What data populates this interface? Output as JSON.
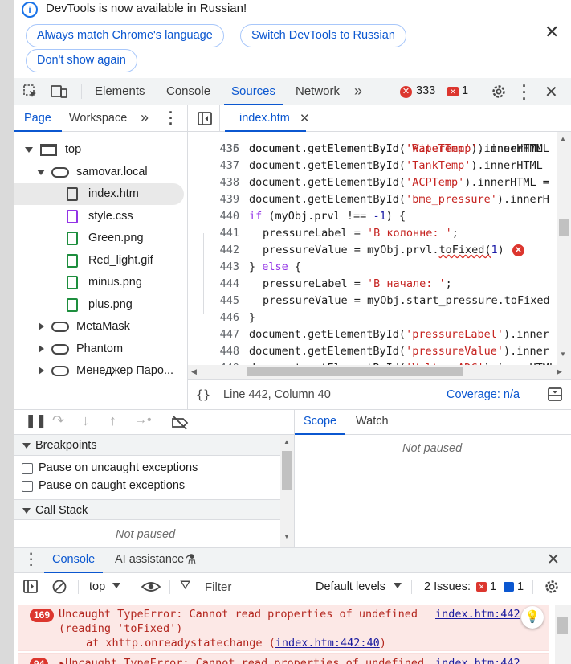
{
  "infobar": {
    "message": "DevTools is now available in Russian!",
    "btn_match": "Always match Chrome's language",
    "btn_switch": "Switch DevTools to Russian",
    "btn_dont_show": "Don't show again"
  },
  "toolbar": {
    "tabs": [
      "Elements",
      "Console",
      "Sources",
      "Network"
    ],
    "active_tab": "Sources",
    "error_count": "333",
    "warning_count": "1"
  },
  "navigator": {
    "tabs": [
      "Page",
      "Workspace"
    ],
    "active_tab": "Page",
    "tree": [
      {
        "label": "top",
        "type": "frame"
      },
      {
        "label": "samovar.local",
        "type": "domain"
      },
      {
        "label": "index.htm",
        "type": "file-html"
      },
      {
        "label": "style.css",
        "type": "file-css"
      },
      {
        "label": "Green.png",
        "type": "file-img"
      },
      {
        "label": "Red_light.gif",
        "type": "file-img"
      },
      {
        "label": "minus.png",
        "type": "file-img"
      },
      {
        "label": "plus.png",
        "type": "file-img"
      },
      {
        "label": "MetaMask",
        "type": "extension"
      },
      {
        "label": "Phantom",
        "type": "extension"
      },
      {
        "label": "Менеджер Паро...",
        "type": "extension"
      }
    ]
  },
  "editor": {
    "open_file": "index.htm",
    "lines": [
      {
        "n": "436",
        "pre": "document.getElementById(",
        "str": "'WaterTemp'",
        "post": ").innerHTML",
        "indent": 0
      },
      {
        "n": "437",
        "pre": "document.getElementById(",
        "str": "'TankTemp'",
        "post": ").innerHTML",
        "indent": 0
      },
      {
        "n": "438",
        "pre": "document.getElementById(",
        "str": "'ACPTemp'",
        "post": ").innerHTML =",
        "indent": 0
      },
      {
        "n": "439",
        "pre": "document.getElementById(",
        "str": "'bme_pressure'",
        "post": ").innerH",
        "indent": 0
      },
      {
        "n": "440",
        "kw": "if",
        "pre": " (myObj.prvl !== ",
        "num": "-1",
        "post": ") {",
        "indent": 0
      },
      {
        "n": "441",
        "pre": "pressureLabel = ",
        "str": "'В колонне: '",
        "post": ";",
        "indent": 1
      },
      {
        "n": "442",
        "pre": "pressureValue = myObj.prvl.",
        "squig": "toFixed(",
        "num": "1",
        "post": ")",
        "indent": 1,
        "error": true
      },
      {
        "n": "443",
        "pre": "} ",
        "kw": "else",
        "post": " {",
        "indent": 0
      },
      {
        "n": "444",
        "pre": "pressureLabel = ",
        "str": "'В начале: '",
        "post": ";",
        "indent": 1
      },
      {
        "n": "445",
        "pre": "pressureValue = myObj.start_pressure.toFixed",
        "indent": 1
      },
      {
        "n": "446",
        "pre": "}",
        "indent": 0
      },
      {
        "n": "447",
        "pre": "document.getElementById(",
        "str": "'pressureLabel'",
        "post": ").inner",
        "indent": 0
      },
      {
        "n": "448",
        "pre": "document.getElementById(",
        "str": "'pressureValue'",
        "post": ").inner",
        "indent": 0
      }
    ],
    "position": "Line 442, Column 40",
    "coverage": "Coverage: n/a"
  },
  "debugger": {
    "breakpoints_title": "Breakpoints",
    "pause_uncaught": "Pause on uncaught exceptions",
    "pause_caught": "Pause on caught exceptions",
    "callstack_title": "Call Stack",
    "not_paused": "Not paused",
    "scope_tabs": [
      "Scope",
      "Watch"
    ],
    "scope_status": "Not paused"
  },
  "drawer": {
    "tabs": [
      "Console",
      "AI assistance"
    ],
    "context": "top",
    "filter_placeholder": "Filter",
    "levels": "Default levels",
    "issues_label": "2 Issues:",
    "issues_errors": "1",
    "issues_info": "1"
  },
  "console_messages": [
    {
      "count": "169",
      "line1": "Uncaught TypeError: Cannot read properties of undefined",
      "line2": "(reading 'toFixed')",
      "stack_prefix": "at xhttp.onreadystatechange (",
      "stack_link": "index.htm:442:40",
      "stack_suffix": ")",
      "source": "index.htm:442"
    },
    {
      "count": "94",
      "line1": "▸Uncaught TypeError: Cannot read properties of undefined",
      "source": "index.htm:442"
    }
  ],
  "colors": {
    "accent": "#0b57d0",
    "error": "#dc362e",
    "string": "#c5221f",
    "keyword": "#9334e6"
  }
}
